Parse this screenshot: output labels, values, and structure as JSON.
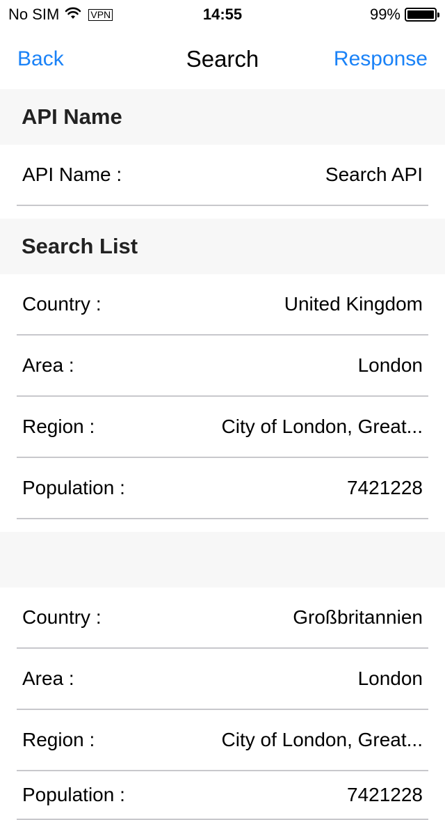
{
  "status": {
    "carrier": "No SIM",
    "vpn": "VPN",
    "time": "14:55",
    "battery": "99%",
    "battery_level": 0.99
  },
  "nav": {
    "back_label": "Back",
    "title": "Search",
    "action_label": "Response"
  },
  "api_section": {
    "header": "API Name",
    "rows": [
      {
        "label": "API Name :",
        "value": "Search API"
      }
    ]
  },
  "search_section": {
    "header": "Search List",
    "results": [
      {
        "rows": [
          {
            "label": "Country :",
            "value": "United Kingdom"
          },
          {
            "label": "Area :",
            "value": "London"
          },
          {
            "label": "Region :",
            "value": "City of London, Great..."
          },
          {
            "label": "Population :",
            "value": "7421228"
          }
        ]
      },
      {
        "rows": [
          {
            "label": "Country :",
            "value": "Großbritannien"
          },
          {
            "label": "Area :",
            "value": "London"
          },
          {
            "label": "Region :",
            "value": "City of London, Great..."
          },
          {
            "label": "Population :",
            "value": "7421228"
          }
        ]
      }
    ]
  }
}
